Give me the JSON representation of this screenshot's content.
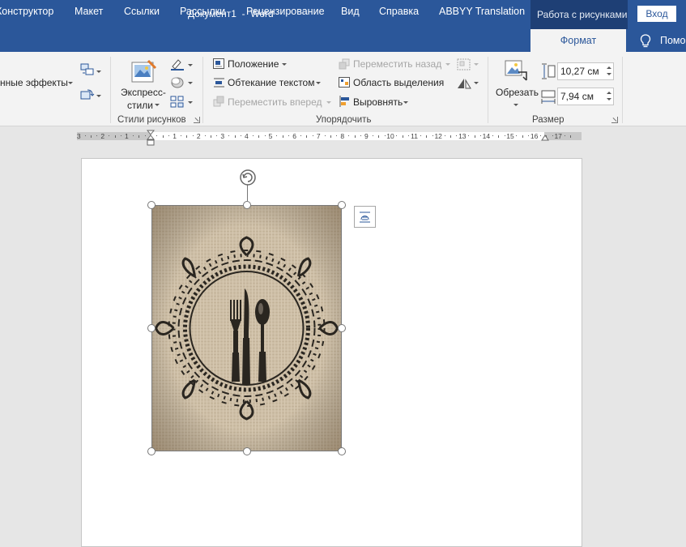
{
  "titlebar": {
    "document_title": "Документ1  -  Word",
    "context_tab": "Работа с рисунками",
    "signin": "Вход"
  },
  "tabs": [
    "Конструктор",
    "Макет",
    "Ссылки",
    "Рассылки",
    "Рецензирование",
    "Вид",
    "Справка",
    "ABBYY Translation"
  ],
  "active_tab": "Формат",
  "tell_me": "Помо",
  "ribbon": {
    "picture_effects_label": "нные эффекты",
    "express_styles_line1": "Экспресс-",
    "express_styles_line2": "стили",
    "group_picture_styles": "Стили рисунков",
    "position": "Положение",
    "wrap_text": "Обтекание текстом",
    "bring_forward": "Переместить вперед",
    "send_backward": "Переместить назад",
    "selection_pane": "Область выделения",
    "align": "Выровнять",
    "group_arrange": "Упорядочить",
    "crop": "Обрезать",
    "height": "10,27 см",
    "width": "7,94 см",
    "group_size": "Размер"
  },
  "ruler": {
    "numbers": [
      "3",
      "2",
      "1",
      "1",
      "2",
      "3",
      "4",
      "5",
      "6",
      "7",
      "8",
      "9",
      "10",
      "11",
      "12",
      "13",
      "14",
      "15",
      "16",
      "17"
    ]
  },
  "colors": {
    "accent": "#2b579a",
    "accent_dark": "#1e3f75",
    "ribbon_bg": "#f3f3f3",
    "workspace_bg": "#e6e6e6",
    "burlap": "#cfc0a8"
  },
  "icons": [
    "rotate-handle-icon",
    "layout-options-icon",
    "lightbulb-icon",
    "crop-icon",
    "height-icon",
    "width-icon"
  ]
}
